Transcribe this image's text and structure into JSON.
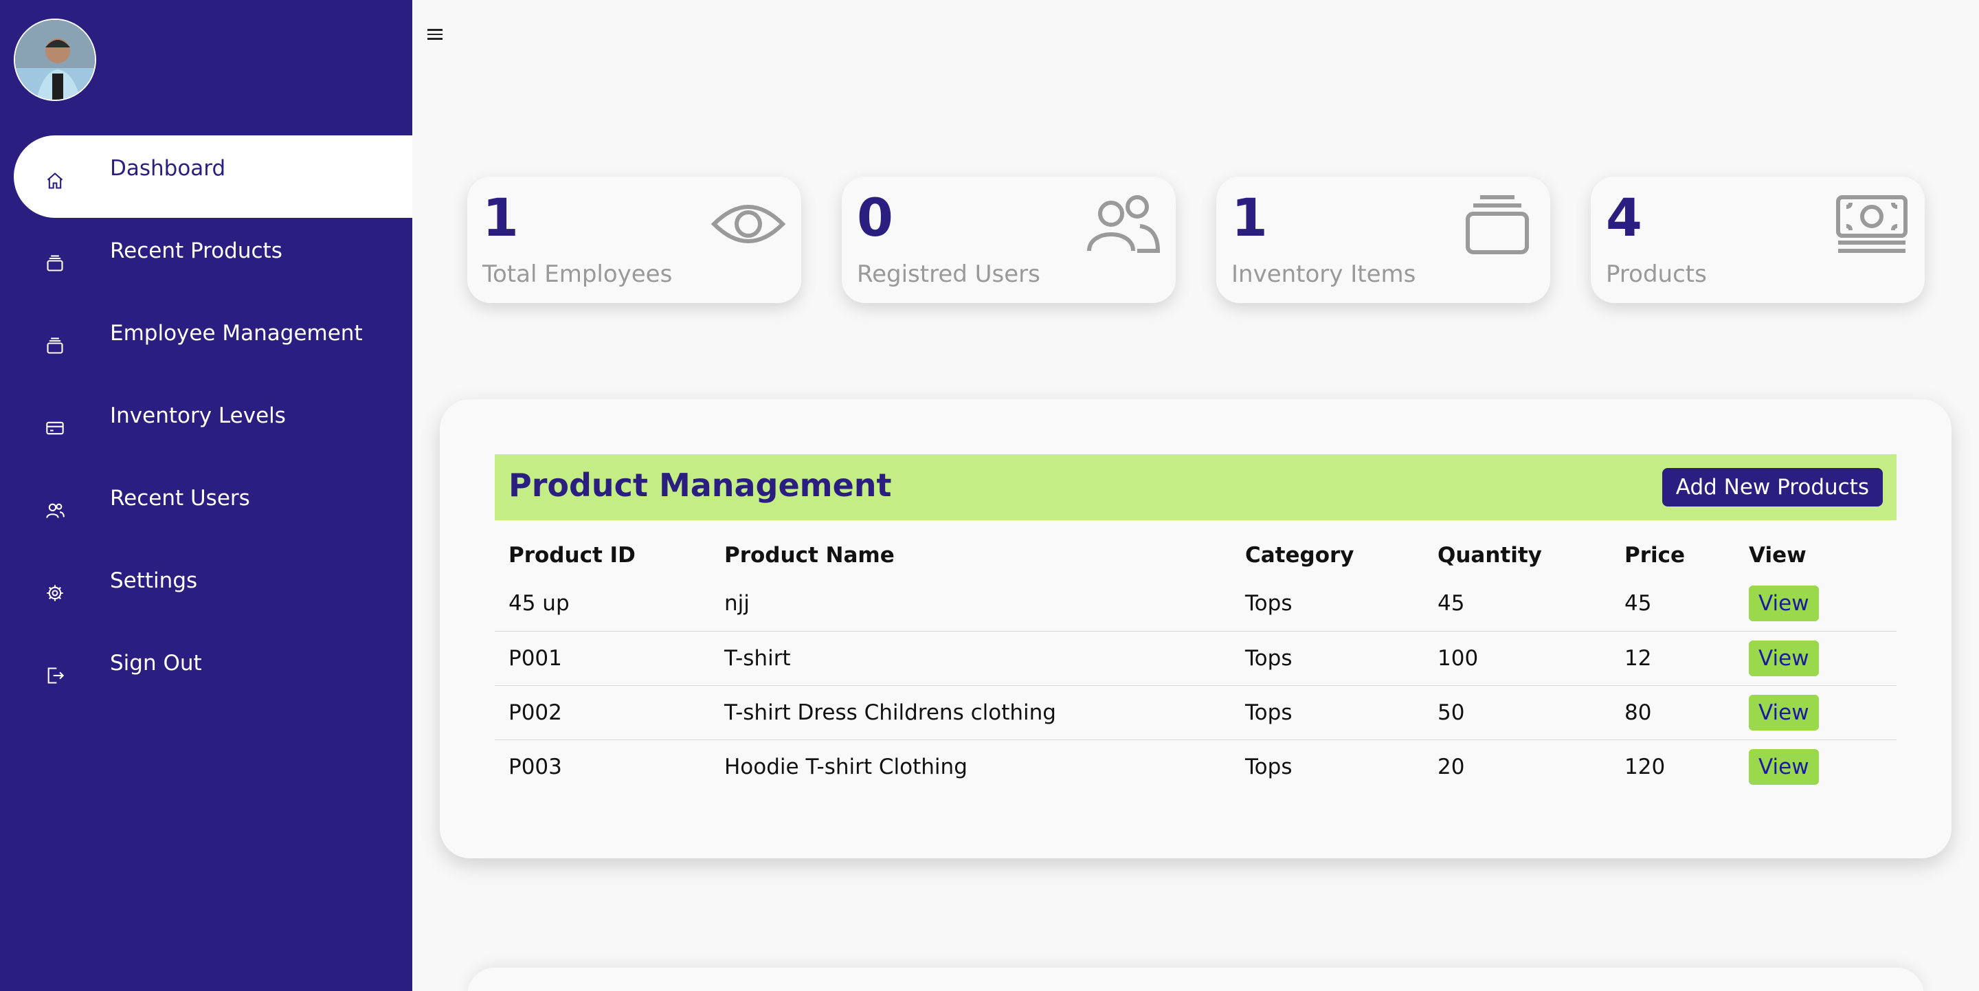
{
  "sidebar": {
    "items": [
      {
        "label": "Dashboard",
        "icon": "home-icon",
        "active": true
      },
      {
        "label": "Recent Products",
        "icon": "box-icon"
      },
      {
        "label": "Employee Management",
        "icon": "box-icon"
      },
      {
        "label": "Inventory Levels",
        "icon": "card-icon"
      },
      {
        "label": "Recent Users",
        "icon": "users-icon"
      },
      {
        "label": "Settings",
        "icon": "gear-icon"
      },
      {
        "label": "Sign Out",
        "icon": "sign-out-icon"
      }
    ]
  },
  "stats": [
    {
      "value": "1",
      "label": "Total Employees",
      "icon": "eye-icon"
    },
    {
      "value": "0",
      "label": "Registred Users",
      "icon": "users-icon"
    },
    {
      "value": "1",
      "label": "Inventory Items",
      "icon": "stack-icon"
    },
    {
      "value": "4",
      "label": "Products",
      "icon": "money-icon"
    }
  ],
  "product_management": {
    "title": "Product Management",
    "add_button": "Add New Products",
    "columns": [
      "Product ID",
      "Product Name",
      "Category",
      "Quantity",
      "Price",
      "View"
    ],
    "rows": [
      {
        "id": "45 up",
        "name": "njj",
        "category": "Tops",
        "quantity": "45",
        "price": "45",
        "view": "View"
      },
      {
        "id": "P001",
        "name": "T-shirt",
        "category": "Tops",
        "quantity": "100",
        "price": "12",
        "view": "View"
      },
      {
        "id": "P002",
        "name": "T-shirt Dress Childrens clothing",
        "category": "Tops",
        "quantity": "50",
        "price": "80",
        "view": "View"
      },
      {
        "id": "P003",
        "name": "Hoodie T-shirt Clothing",
        "category": "Tops",
        "quantity": "20",
        "price": "120",
        "view": "View"
      }
    ]
  },
  "colors": {
    "primary": "#2a1f80",
    "accent": "#c4ee85",
    "button_green": "#9ad94c"
  }
}
